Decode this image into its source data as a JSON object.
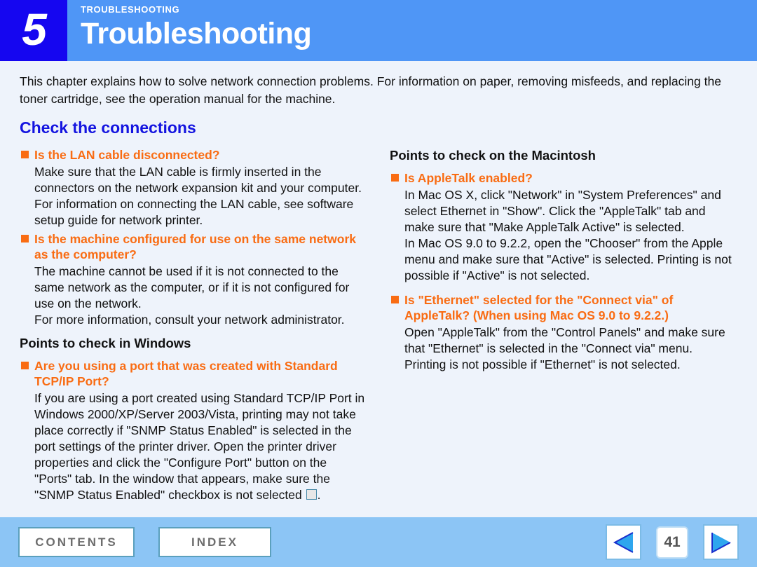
{
  "header": {
    "chapter_number": "5",
    "eyebrow": "TROUBLESHOOTING",
    "title": "Troubleshooting",
    "accent_dark_blue": "#1506f0",
    "accent_blue": "#4f96f6"
  },
  "intro": "This chapter explains how to solve network connection problems. For information on paper, removing misfeeds, and replacing the toner cartridge, see the operation manual for the machine.",
  "section_title": "Check the connections",
  "colors": {
    "section_blue": "#1414e0",
    "question_orange": "#f96c13",
    "body_text": "#111111",
    "page_background": "#eef3fb",
    "footer_background": "#8cc5f5"
  },
  "left_column": {
    "questions_top": [
      {
        "heading": "Is the LAN cable disconnected?",
        "body": "Make sure that the LAN cable is firmly inserted in the connectors on the network expansion kit and your computer. For information on connecting the LAN cable, see software setup guide for network printer."
      },
      {
        "heading": "Is the machine configured for use on the same network as the computer?",
        "body_1": "The machine cannot be used if it is not connected to the same network as the computer, or if it is not configured for use on the network.",
        "body_2": "For more information, consult your network administrator."
      }
    ],
    "subhead": "Points to check in Windows",
    "windows_question": {
      "heading": "Are you using a port that was created with Standard TCP/IP Port?",
      "body_before_checkbox": "If you are using a port created using Standard TCP/IP Port in Windows 2000/XP/Server 2003/Vista, printing may not take place correctly if \"SNMP Status Enabled\" is selected in the port settings of the printer driver. Open the printer driver properties and click the \"Configure Port\" button on the \"Ports\" tab. In the window that appears, make sure the \"SNMP Status Enabled\" checkbox is not selected",
      "body_after_checkbox": "."
    }
  },
  "right_column": {
    "subhead": "Points to check on the Macintosh",
    "questions": [
      {
        "heading": "Is AppleTalk enabled?",
        "body_1": "In Mac OS X, click \"Network\" in \"System Preferences\" and select Ethernet in \"Show\". Click the \"AppleTalk\" tab and make sure that \"Make AppleTalk Active\" is selected.",
        "body_2": "In Mac OS 9.0 to 9.2.2, open the \"Chooser\" from the Apple menu and make sure that \"Active\" is selected. Printing is not possible if \"Active\" is not selected."
      },
      {
        "heading": "Is \"Ethernet\" selected for the \"Connect via\" of AppleTalk? (When using Mac OS 9.0 to 9.2.2.)",
        "body_1": "Open \"AppleTalk\" from the \"Control Panels\" and make sure that \"Ethernet\" is selected in the \"Connect via\" menu.",
        "body_2": "Printing is not possible if \"Ethernet\" is not selected."
      }
    ]
  },
  "footer": {
    "contents_label": "CONTENTS",
    "index_label": "INDEX",
    "page_number": "41",
    "prev_icon": "triangle-left-icon",
    "next_icon": "triangle-right-icon"
  }
}
